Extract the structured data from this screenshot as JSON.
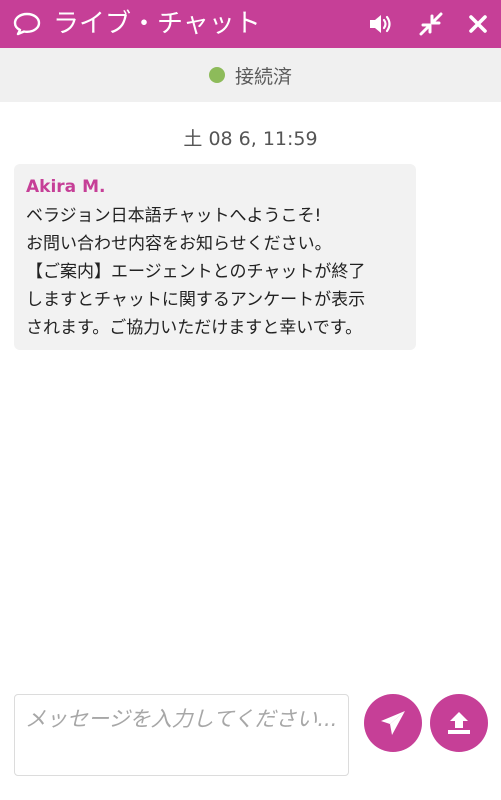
{
  "header": {
    "title": "ライブ・チャット",
    "background": "#c63f97",
    "icons": {
      "chat": "chat-bubble-icon",
      "sound": "speaker-icon",
      "minimize": "minimize-arrows-icon",
      "close": "close-icon"
    }
  },
  "status": {
    "text": "接続済",
    "dot_color": "#8dbb5a"
  },
  "conversation": {
    "timestamp": "土 08 6, 11:59",
    "message": {
      "sender": "Akira M.",
      "lines": [
        "ベラジョン日本語チャットへようこそ!",
        "お問い合わせ内容をお知らせください。",
        "【ご案内】エージェントとのチャットが終了",
        "しますとチャットに関するアンケートが表示",
        "されます。ご協力いただけますと幸いです。"
      ]
    }
  },
  "composer": {
    "placeholder": "メッセージを入力してください...",
    "send_icon": "paper-plane-icon",
    "upload_icon": "upload-icon"
  }
}
